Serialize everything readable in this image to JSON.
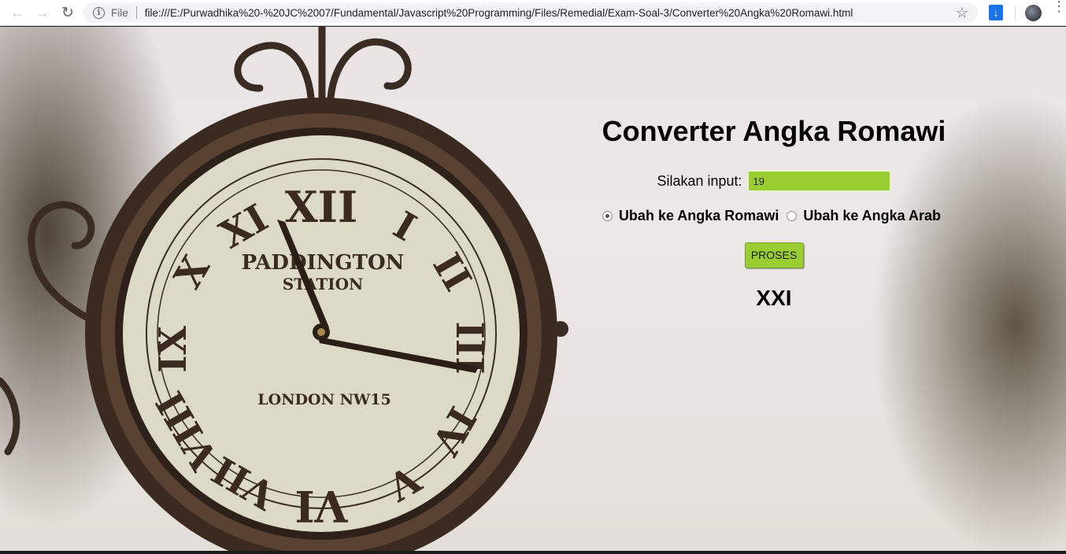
{
  "browser": {
    "scheme": "File",
    "url": "file:///E:/Purwadhika%20-%20JC%2007/Fundamental/Javascript%20Programming/Files/Remedial/Exam-Soal-3/Converter%20Angka%20Romawi.html",
    "icons": [
      "back-arrow-icon",
      "forward-arrow-icon",
      "reload-icon",
      "info-icon",
      "star-icon",
      "download-icon",
      "avatar",
      "menu-icon"
    ]
  },
  "background": {
    "clock_text": [
      "PADDINGTON",
      "STATION",
      "LONDON NW15"
    ]
  },
  "converter": {
    "title": "Converter Angka Romawi",
    "input_label": "Silakan input:",
    "input_value": "19",
    "radio_roman_label": "Ubah ke Angka Romawi",
    "radio_arab_label": "Ubah ke Angka Arab",
    "selected_option": "Ubah ke Angka Romawi",
    "button_label": "PROSES",
    "result": "XXI",
    "accent_color": "#9acd32"
  }
}
